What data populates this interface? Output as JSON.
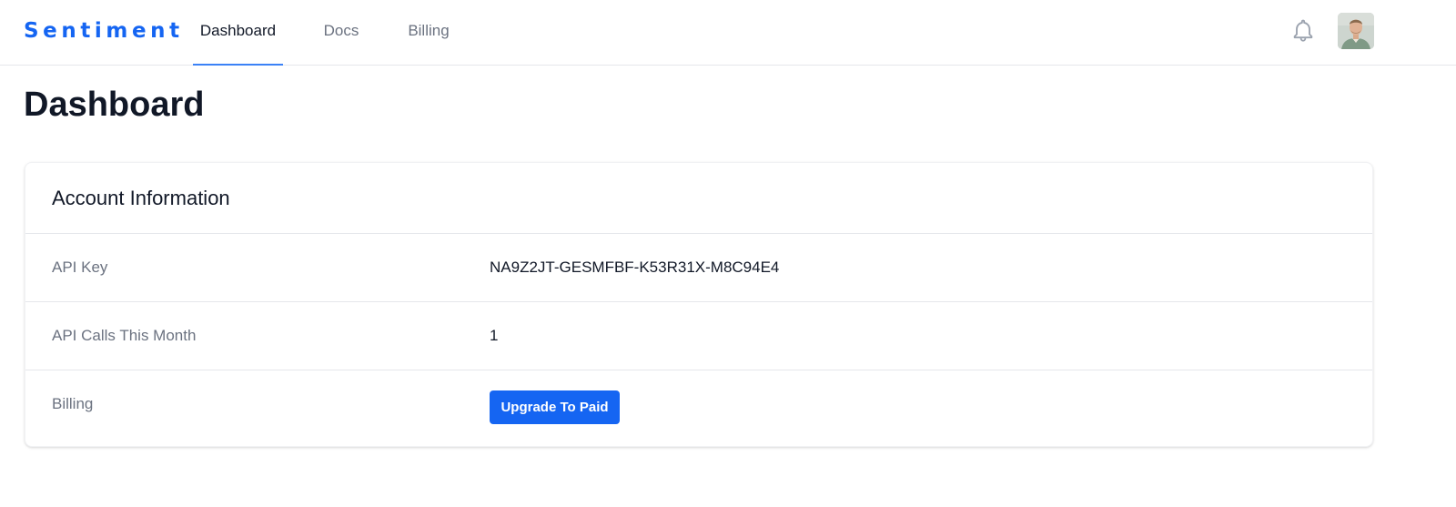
{
  "nav": {
    "logo": "Sentiment",
    "tabs": [
      {
        "label": "Dashboard",
        "active": true
      },
      {
        "label": "Docs",
        "active": false
      },
      {
        "label": "Billing",
        "active": false
      }
    ],
    "notification_icon": "bell-icon",
    "accent_color": "#1565f2"
  },
  "page": {
    "title": "Dashboard"
  },
  "account_card": {
    "title": "Account Information",
    "rows": [
      {
        "label": "API Key",
        "value": "NA9Z2JT-GESMFBF-K53R31X-M8C94E4"
      },
      {
        "label": "API Calls This Month",
        "value": "1"
      },
      {
        "label": "Billing",
        "button_label": "Upgrade To Paid"
      }
    ]
  }
}
